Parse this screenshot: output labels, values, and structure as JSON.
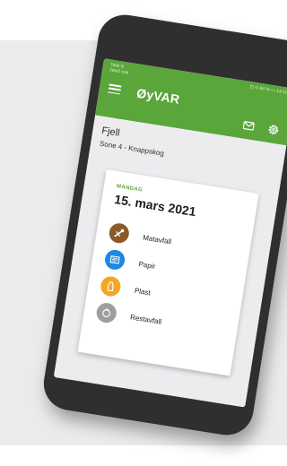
{
  "colors": {
    "primary_green": "#5aa63b",
    "matavfall": "#8a5a2b",
    "papir": "#1e88e5",
    "plast": "#f5a623",
    "restavfall": "#9e9e9e"
  },
  "statusbar": {
    "carrier_top": "Telia N",
    "carrier_bottom": "Tele2 oak",
    "right": "⊡ ⊙ 84 % ▭ 14:10"
  },
  "appbar": {
    "title": "ØyVAR",
    "icons": [
      "menu-icon",
      "mail-icon",
      "gear-icon"
    ]
  },
  "location": {
    "name": "Fjell",
    "zone": "Sone 4 - Knappskog"
  },
  "pickup": {
    "day": "MANDAG",
    "date": "15. mars 2021",
    "fractions": [
      {
        "label": "Matavfall",
        "icon": "food-waste-icon"
      },
      {
        "label": "Papir",
        "icon": "paper-icon"
      },
      {
        "label": "Plast",
        "icon": "plastic-icon"
      },
      {
        "label": "Restavfall",
        "icon": "residual-waste-icon"
      }
    ]
  }
}
